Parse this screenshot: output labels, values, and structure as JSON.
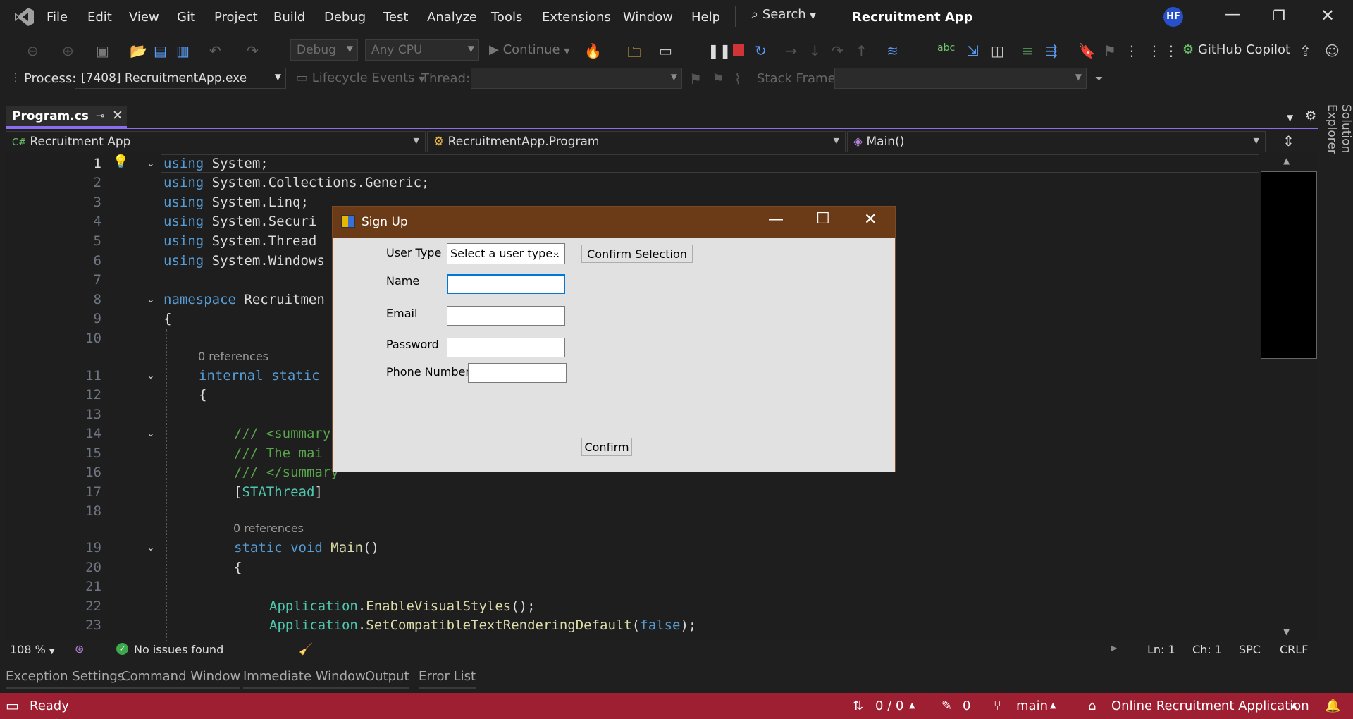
{
  "menubar": {
    "items": [
      "File",
      "Edit",
      "View",
      "Git",
      "Project",
      "Build",
      "Debug",
      "Test",
      "Analyze",
      "Tools",
      "Extensions",
      "Window",
      "Help"
    ],
    "search": "Search",
    "solution_name": "Recruitment App",
    "avatar": "HF"
  },
  "toolbar": {
    "config": "Debug",
    "platform": "Any CPU",
    "continue": "Continue",
    "copilot": "GitHub Copilot"
  },
  "debugbar": {
    "process_label": "Process:",
    "process_value": "[7408] RecruitmentApp.exe",
    "lifecycle": "Lifecycle Events",
    "thread_label": "Thread:",
    "stack_label": "Stack Frame:"
  },
  "tabs": {
    "active": "Program.cs"
  },
  "navbar": {
    "project": "Recruitment App",
    "class": "RecruitmentApp.Program",
    "member": "Main()"
  },
  "editor": {
    "line_numbers": [
      "1",
      "2",
      "3",
      "4",
      "5",
      "6",
      "7",
      "8",
      "9",
      "10",
      "11",
      "12",
      "13",
      "14",
      "15",
      "16",
      "17",
      "18",
      "19",
      "20",
      "21",
      "22",
      "23"
    ],
    "ref1": "0 references",
    "ref2": "0 references",
    "l1a": "using",
    "l1b": " System;",
    "l2a": "using",
    "l2b": " System.Collections.Generic;",
    "l3a": "using",
    "l3b": " System.Linq;",
    "l4a": "using",
    "l4b": " System.Securi",
    "l5a": "using",
    "l5b": " System.Thread",
    "l6a": "using",
    "l6b": " System.Windows",
    "l8a": "namespace",
    "l8b": " Recruitmen",
    "l9": "{",
    "l11a": "internal",
    "l11b": " static",
    "l12": "{",
    "l14": "/// <summary",
    "l15": "/// The mai",
    "l16": "/// </summary",
    "l17a": "[",
    "l17b": "STAThread",
    "l17c": "]",
    "l19a": "static",
    "l19b": " void",
    "l19c": " Main",
    "l19d": "()",
    "l20": "{",
    "l22a": "Application",
    "l22b": ".",
    "l22c": "EnableVisualStyles",
    "l22d": "();",
    "l23a": "Application",
    "l23b": ".",
    "l23c": "SetCompatibleTextRenderingDefault",
    "l23d": "(",
    "l23e": "false",
    "l23f": ");"
  },
  "editor_status": {
    "zoom": "108 %",
    "issues": "No issues found",
    "ln": "Ln: 1",
    "ch": "Ch: 1",
    "spc": "SPC",
    "crlf": "CRLF"
  },
  "bottom_tabs": [
    "Exception Settings",
    "Command Window",
    "Immediate Window",
    "Output",
    "Error List"
  ],
  "statusbar": {
    "ready": "Ready",
    "sync": "0 / 0",
    "edits": "0",
    "branch": "main",
    "repo": "Online Recruitment Application"
  },
  "side": {
    "solution_explorer": "Solution Explorer"
  },
  "dialog": {
    "title": "Sign Up",
    "user_type_label": "User Type",
    "user_type_value": "Select a user type..",
    "confirm_selection": "Confirm Selection",
    "name_label": "Name",
    "email_label": "Email",
    "password_label": "Password",
    "phone_label": "Phone Number",
    "name_value": "",
    "email_value": "",
    "password_value": "",
    "phone_value": "",
    "confirm": "Confirm"
  },
  "colors": {
    "accent_purple": "#8c6cf0",
    "status_bar": "#9e1e32",
    "dialog_titlebar": "#6b3a16"
  }
}
